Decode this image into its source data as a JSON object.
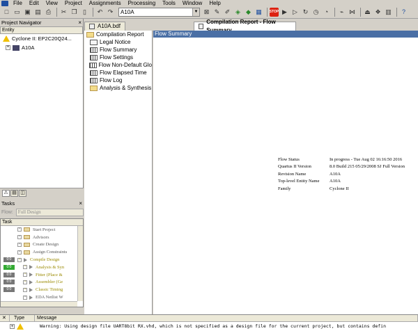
{
  "menu": {
    "items": [
      "File",
      "Edit",
      "View",
      "Project",
      "Assignments",
      "Processing",
      "Tools",
      "Window",
      "Help"
    ]
  },
  "toolbar": {
    "entity_value": "A10A"
  },
  "navigator": {
    "title": "Project Navigator",
    "column": "Entity",
    "device": "Cyclone II: EP2C20Q24...",
    "entity": "A10A"
  },
  "tasks": {
    "title": "Tasks",
    "flow_label": "Flow:",
    "flow_value": "Full Design",
    "column": "Task",
    "items": [
      {
        "status": "",
        "label": "Start Project",
        "gold": false
      },
      {
        "status": "",
        "label": "Advisors",
        "gold": false
      },
      {
        "status": "",
        "label": "Create Design",
        "gold": false
      },
      {
        "status": "",
        "label": "Assign Constraints",
        "gold": false
      },
      {
        "status": "0:0",
        "label": "Compile Design",
        "gold": true
      },
      {
        "status": "0:0",
        "label": "Analysis & Syn",
        "gold": true
      },
      {
        "status": "0:0",
        "label": "Fitter (Place &",
        "gold": true
      },
      {
        "status": "0:0",
        "label": "Assembler (Ge",
        "gold": true
      },
      {
        "status": "0:0",
        "label": "Classic Timing",
        "gold": true
      },
      {
        "status": "",
        "label": "EDA Netlist W",
        "gold": false
      }
    ]
  },
  "doc_tabs": {
    "bdf": "A10A.bdf",
    "report": "Compilation Report - Flow Summary"
  },
  "report_tree": {
    "root": "Compilation Report",
    "items": [
      "Legal Notice",
      "Flow Summary",
      "Flow Settings",
      "Flow Non-Default Glo",
      "Flow Elapsed Time",
      "Flow Log",
      "Analysis & Synthesis"
    ]
  },
  "content": {
    "header": "Flow Summary",
    "rows": [
      {
        "key": "Flow Status",
        "value": "In progress - Tue Aug 02 16:16:50 2016"
      },
      {
        "key": "Quartus II Version",
        "value": "8.0 Build 215 05/29/2008 SJ Full Version"
      },
      {
        "key": "Revision Name",
        "value": "A10A"
      },
      {
        "key": "Top-level Entity Name",
        "value": "A10A"
      },
      {
        "key": "Family",
        "value": "Cyclone II"
      }
    ]
  },
  "messages": {
    "col_type": "Type",
    "col_message": "Message",
    "row": "Warning: Using design file UART8bit RX.vhd, which is not specified as a design file for the current project, but contains defin"
  }
}
